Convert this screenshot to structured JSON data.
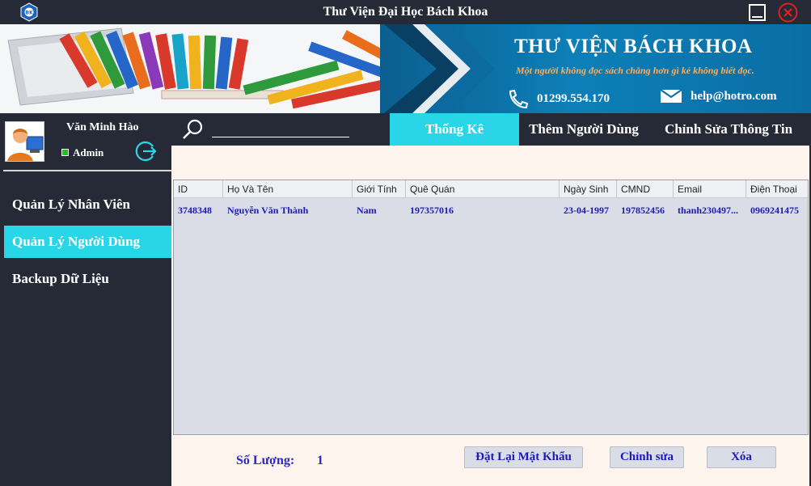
{
  "window": {
    "title": "Thư Viện Đại Học Bách Khoa",
    "logo_icon": "university-logo-icon",
    "minimize_icon": "minimize-icon",
    "close_icon": "close-circle-icon"
  },
  "banner": {
    "title": "THƯ VIỆN BÁCH KHOA",
    "slogan": "Một người không đọc sách chẳng hơn gì kẻ không biết đọc.",
    "phone": "01299.554.170",
    "email": "help@hotro.com"
  },
  "user": {
    "name": "Văn Minh Hào",
    "role": "Admin",
    "status_color": "#18c718"
  },
  "sidebar": {
    "items": [
      {
        "label": "Quản Lý Nhân Viên",
        "active": false
      },
      {
        "label": "Quản Lý Người Dùng",
        "active": true
      },
      {
        "label": "Backup Dữ Liệu",
        "active": false
      }
    ]
  },
  "search": {
    "value": "",
    "placeholder": ""
  },
  "tabs": [
    {
      "label": "Thống Kê",
      "active": true
    },
    {
      "label": "Thêm Người Dùng",
      "active": false
    },
    {
      "label": "Chỉnh Sửa Thông Tin",
      "active": false
    }
  ],
  "table": {
    "columns": [
      "ID",
      "Họ Và Tên",
      "Giới Tính",
      "Quê Quán",
      "Ngày Sinh",
      "CMND",
      "Email",
      "Điện Thoại"
    ],
    "rows": [
      [
        "3748348",
        "Nguyễn Văn Thành",
        "Nam",
        "197357016",
        "23-04-1997",
        "197852456",
        "thanh230497...",
        "0969241475"
      ]
    ]
  },
  "footer": {
    "count_label": "Số Lượng:",
    "count_value": "1",
    "reset_password_label": "Đặt Lại Mật Khẩu",
    "edit_label": "Chỉnh sửa",
    "delete_label": "Xóa"
  },
  "colors": {
    "dark": "#262a37",
    "accent": "#29d6e8",
    "text_blue": "#1d1ab8"
  }
}
